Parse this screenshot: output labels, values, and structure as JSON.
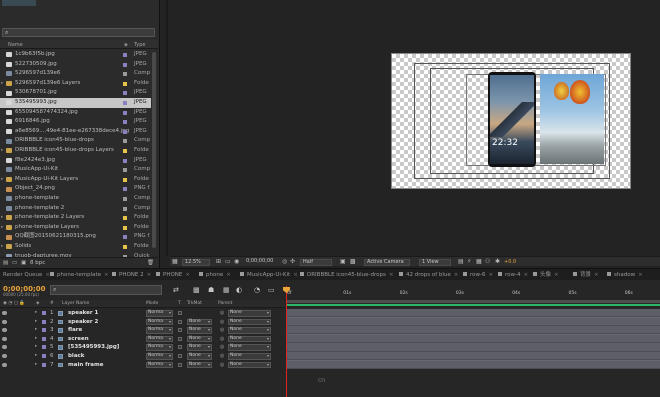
{
  "project": {
    "search_placeholder": "",
    "columns": {
      "name": "Name",
      "type": "Type"
    },
    "items": [
      {
        "expand": "",
        "icon": "image-icon",
        "name": "1c9b63f5b.jpg",
        "label_color": "#8a7fbf",
        "type": "JPEG",
        "selected": false
      },
      {
        "expand": "",
        "icon": "image-icon",
        "name": "522730509.jpg",
        "label_color": "#8a7fbf",
        "type": "JPEG",
        "selected": false
      },
      {
        "expand": "",
        "icon": "composition-icon",
        "name": "5296597d139e6",
        "label_color": "#9a9a9a",
        "type": "Comp",
        "selected": false
      },
      {
        "expand": "▸",
        "icon": "folder-icon",
        "name": "5296597d139e6 Layers",
        "label_color": "#e6c34a",
        "type": "Folde",
        "selected": false
      },
      {
        "expand": "",
        "icon": "image-icon",
        "name": "530678701.jpg",
        "label_color": "#8a7fbf",
        "type": "JPEG",
        "selected": false
      },
      {
        "expand": "",
        "icon": "image-icon",
        "name": "535495993.jpg",
        "label_color": "#8a7fbf",
        "type": "JPEG",
        "selected": true
      },
      {
        "expand": "",
        "icon": "image-icon",
        "name": "655094587474324.jpg",
        "label_color": "#8a7fbf",
        "type": "JPEG",
        "selected": false
      },
      {
        "expand": "",
        "icon": "image-icon",
        "name": "6916846.jpg",
        "label_color": "#8a7fbf",
        "type": "JPEG",
        "selected": false
      },
      {
        "expand": "",
        "icon": "image-icon",
        "name": "a6e8569....49e4-81ee-e267338dece4.jpg",
        "label_color": "#8a7fbf",
        "type": "JPEG",
        "selected": false
      },
      {
        "expand": "",
        "icon": "composition-icon",
        "name": "DRIBBBLE icon45-blue-drops",
        "label_color": "#9a9a9a",
        "type": "Comp",
        "selected": false
      },
      {
        "expand": "▸",
        "icon": "folder-icon",
        "name": "DRIBBBLE icon45-blue-drops Layers",
        "label_color": "#e6c34a",
        "type": "Folde",
        "selected": false
      },
      {
        "expand": "",
        "icon": "image-icon",
        "name": "f8e2424e3.jpg",
        "label_color": "#8a7fbf",
        "type": "JPEG",
        "selected": false
      },
      {
        "expand": "",
        "icon": "composition-icon",
        "name": "MusicApp-Ui-Kit",
        "label_color": "#9a9a9a",
        "type": "Comp",
        "selected": false
      },
      {
        "expand": "▸",
        "icon": "folder-icon",
        "name": "MusicApp-Ui-Kit Layers",
        "label_color": "#e6c34a",
        "type": "Folde",
        "selected": false
      },
      {
        "expand": "",
        "icon": "png-icon",
        "name": "Object_24.png",
        "label_color": "#8a7fbf",
        "type": "PNG f",
        "selected": false
      },
      {
        "expand": "",
        "icon": "composition-icon",
        "name": "phone-template",
        "label_color": "#9a9a9a",
        "type": "Comp",
        "selected": false
      },
      {
        "expand": "",
        "icon": "composition-icon",
        "name": "phone-template 2",
        "label_color": "#9a9a9a",
        "type": "Comp",
        "selected": false
      },
      {
        "expand": "▸",
        "icon": "folder-icon",
        "name": "phone-template 2 Layers",
        "label_color": "#e6c34a",
        "type": "Folde",
        "selected": false
      },
      {
        "expand": "▸",
        "icon": "folder-icon",
        "name": "phone-template Layers",
        "label_color": "#e6c34a",
        "type": "Folde",
        "selected": false
      },
      {
        "expand": "",
        "icon": "png-icon",
        "name": "QQ截图20150621180315.png",
        "label_color": "#8a7fbf",
        "type": "PNG f",
        "selected": false
      },
      {
        "expand": "▸",
        "icon": "folder-icon",
        "name": "Solids",
        "label_color": "#e6c34a",
        "type": "Folde",
        "selected": false
      },
      {
        "expand": "",
        "icon": "audio-icon",
        "name": "tnuob-dapturee.mov",
        "label_color": "#9a9a9a",
        "type": "Quick",
        "selected": false
      }
    ],
    "footer": {
      "bpc": "8 bpc"
    }
  },
  "viewer": {
    "footer": {
      "zoom": "12.5%",
      "timecode": "0;00;00;00",
      "resolution": "Half",
      "camera": "Active Camera",
      "view": "1 View",
      "exposure": "+0.0"
    },
    "screen": {
      "time": "22:32",
      "date": ""
    }
  },
  "tabs": [
    {
      "label": "Render Queue",
      "color": "",
      "active": false
    },
    {
      "label": "phone-template",
      "color": "#9a9a9a",
      "active": false
    },
    {
      "label": "PHONE 2",
      "color": "#9a9a9a",
      "active": false
    },
    {
      "label": "PHONE",
      "color": "#9a9a9a",
      "active": false
    },
    {
      "label": "phone",
      "color": "#9a9a9a",
      "active": false
    },
    {
      "label": "MusicApp-Ui-Kit",
      "color": "#9a9a9a",
      "active": false
    },
    {
      "label": "DRIBBBLE icon45-blue-drops",
      "color": "#9a9a9a",
      "active": false
    },
    {
      "label": "42 drops of blue",
      "color": "#9a9a9a",
      "active": false
    },
    {
      "label": "row-6",
      "color": "#9a9a9a",
      "active": false
    },
    {
      "label": "row-4",
      "color": "#9a9a9a",
      "active": false
    },
    {
      "label": "头像",
      "color": "#9a9a9a",
      "active": false
    },
    {
      "label": "背景",
      "color": "#9a9a9a",
      "active": false
    },
    {
      "label": "shadow",
      "color": "#9a9a9a",
      "active": false
    }
  ],
  "timeline": {
    "timecode": "0;00;00;00",
    "timecode_sub": "00000 (25.00 fps)",
    "search_placeholder": "",
    "columns": {
      "layer_name": "Layer Name",
      "mode": "Mode",
      "t": "T",
      "trkmat": "TrkMat",
      "parent": "Parent"
    },
    "ticks": [
      "0f",
      "01s",
      "02s",
      "03s",
      "04s",
      "05s",
      "06s"
    ],
    "layers": [
      {
        "num": "1",
        "name": "speaker 1",
        "label_color": "#8a7fbf",
        "mode": "Norma",
        "trkmat": "",
        "parent": "None"
      },
      {
        "num": "2",
        "name": "speaker 2",
        "label_color": "#8a7fbf",
        "mode": "Norma",
        "trkmat": "None",
        "parent": "None"
      },
      {
        "num": "3",
        "name": "flare",
        "label_color": "#8a7fbf",
        "mode": "Norma",
        "trkmat": "None",
        "parent": "None"
      },
      {
        "num": "4",
        "name": "screen",
        "label_color": "#8a7fbf",
        "mode": "Norma",
        "trkmat": "None",
        "parent": "None"
      },
      {
        "num": "5",
        "name": "[535495993.jpg]",
        "label_color": "#8a7fbf",
        "mode": "Norma",
        "trkmat": "None",
        "parent": "None"
      },
      {
        "num": "6",
        "name": "black",
        "label_color": "#8a7fbf",
        "mode": "Norma",
        "trkmat": "None",
        "parent": "None"
      },
      {
        "num": "7",
        "name": "main frame",
        "label_color": "#8a7fbf",
        "mode": "Norma",
        "trkmat": "None",
        "parent": "None"
      }
    ]
  },
  "watermark": "cn"
}
